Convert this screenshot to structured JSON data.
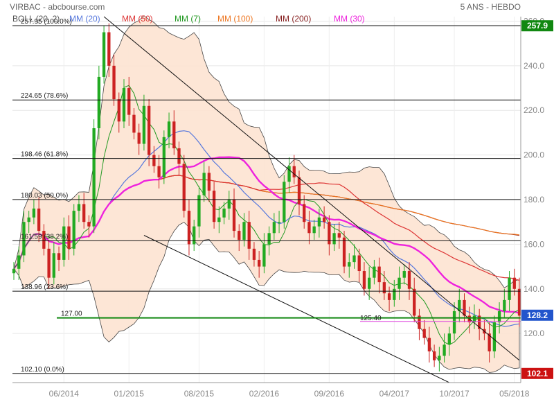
{
  "chart_data": {
    "type": "line",
    "title_left": "VIRBAC - abcbourse.com",
    "title_right": "5 ANS - HEBDO",
    "legend": [
      {
        "label": "BOLL (20, 2)",
        "color": "#555555"
      },
      {
        "label": "MM (20)",
        "color": "#5577dd"
      },
      {
        "label": "MM (50)",
        "color": "#dd3333"
      },
      {
        "label": "MM (7)",
        "color": "#229922"
      },
      {
        "label": "MM (100)",
        "color": "#ee7722"
      },
      {
        "label": "MM (200)",
        "color": "#882222"
      },
      {
        "label": "MM (30)",
        "color": "#ee22dd"
      }
    ],
    "x_ticks": [
      "06/2014",
      "01/2015",
      "08/2015",
      "02/2016",
      "09/2016",
      "04/2017",
      "10/2017",
      "05/2018"
    ],
    "y_ticks": [
      120,
      140,
      160,
      180,
      200,
      220,
      240,
      260
    ],
    "ylim": [
      98,
      262
    ],
    "grid": true,
    "fib_levels": [
      {
        "label": "257.95  (100.0%)",
        "value": 257.95
      },
      {
        "label": "224.65  (78.6%)",
        "value": 224.65
      },
      {
        "label": "198.46  (61.8%)",
        "value": 198.46
      },
      {
        "label": "180.03  (50.0%)",
        "value": 180.03
      },
      {
        "label": "161.59  (38.2%)",
        "value": 161.59
      },
      {
        "label": "138.96  (23.6%)",
        "value": 138.96
      },
      {
        "label": "102.10  (0.0%)",
        "value": 102.1
      }
    ],
    "support_line": {
      "label": "127.00",
      "value": 127.0,
      "color": "#118811"
    },
    "inline_label": {
      "text": "125.40",
      "value": 125.4,
      "color": "#dd44dd"
    },
    "price_tags": [
      {
        "text": "257.9",
        "value": 257.9,
        "color": "#118811"
      },
      {
        "text": "128.2",
        "value": 128.2,
        "color": "#2255cc"
      },
      {
        "text": "102.1",
        "value": 102.1,
        "color": "#cc1111"
      }
    ],
    "price_series": {
      "name": "VIRBAC",
      "values": [
        149,
        155,
        170,
        172,
        176,
        166,
        158,
        145,
        156,
        153,
        168,
        158,
        175,
        178,
        170,
        168,
        212,
        235,
        255,
        240,
        225,
        215,
        230,
        218,
        210,
        205,
        222,
        200,
        195,
        190,
        208,
        215,
        203,
        196,
        175,
        160,
        168,
        182,
        192,
        184,
        170,
        172,
        176,
        180,
        166,
        162,
        170,
        158,
        153,
        150,
        160,
        165,
        170,
        170,
        188,
        195,
        190,
        178,
        170,
        165,
        168,
        172,
        170,
        160,
        165,
        163,
        150,
        152,
        155,
        148,
        140,
        145,
        150,
        143,
        138,
        135,
        140,
        145,
        148,
        140,
        128,
        122,
        118,
        112,
        108,
        110,
        115,
        120,
        130,
        135,
        128,
        125,
        128,
        122,
        120,
        112,
        125,
        130,
        135,
        145,
        140,
        128
      ]
    }
  }
}
